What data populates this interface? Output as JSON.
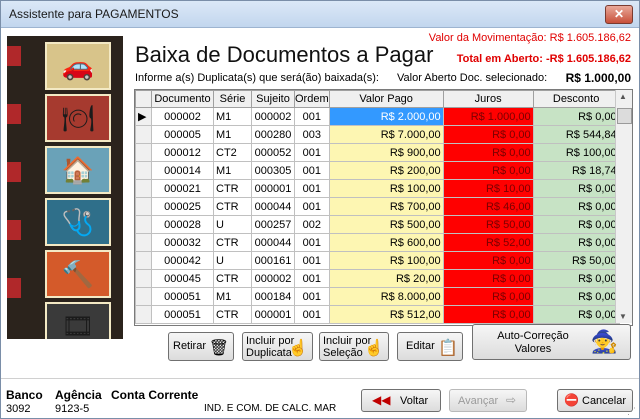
{
  "window": {
    "title": "Assistente para PAGAMENTOS",
    "close_glyph": "✕"
  },
  "header": {
    "heading": "Baixa de Documentos a Pagar",
    "movimentacao": "Valor da Movimentação: R$ 1.605.186,62",
    "aberto": "Total em Aberto: -R$ 1.605.186,62",
    "informe": "Informe a(s) Duplicata(s) que será(ão) baixada(s):",
    "valor_sel_label": "Valor Aberto Doc. selecionado:",
    "valor_sel": "R$ 1.000,00"
  },
  "grid": {
    "columns": [
      "Documento",
      "Série",
      "Sujeito",
      "Ordem",
      "Valor Pago",
      "Juros",
      "Desconto"
    ],
    "current_indicator": "▶",
    "rows": [
      {
        "documento": "000002",
        "serie": "M1",
        "sujeito": "000002",
        "ordem": "001",
        "valor_pago": "R$ 2.000,00",
        "juros": "R$ 1.000,00",
        "desconto": "R$ 0,00"
      },
      {
        "documento": "000005",
        "serie": "M1",
        "sujeito": "000280",
        "ordem": "003",
        "valor_pago": "R$ 7.000,00",
        "juros": "R$ 0,00",
        "desconto": "R$ 544,84"
      },
      {
        "documento": "000012",
        "serie": "CT2",
        "sujeito": "000052",
        "ordem": "001",
        "valor_pago": "R$ 900,00",
        "juros": "R$ 0,00",
        "desconto": "R$ 100,00"
      },
      {
        "documento": "000014",
        "serie": "M1",
        "sujeito": "000305",
        "ordem": "001",
        "valor_pago": "R$ 200,00",
        "juros": "R$ 0,00",
        "desconto": "R$ 18,74"
      },
      {
        "documento": "000021",
        "serie": "CTR",
        "sujeito": "000001",
        "ordem": "001",
        "valor_pago": "R$ 100,00",
        "juros": "R$ 10,00",
        "desconto": "R$ 0,00"
      },
      {
        "documento": "000025",
        "serie": "CTR",
        "sujeito": "000044",
        "ordem": "001",
        "valor_pago": "R$ 700,00",
        "juros": "R$ 46,00",
        "desconto": "R$ 0,00"
      },
      {
        "documento": "000028",
        "serie": "U",
        "sujeito": "000257",
        "ordem": "002",
        "valor_pago": "R$ 500,00",
        "juros": "R$ 50,00",
        "desconto": "R$ 0,00"
      },
      {
        "documento": "000032",
        "serie": "CTR",
        "sujeito": "000044",
        "ordem": "001",
        "valor_pago": "R$ 600,00",
        "juros": "R$ 52,00",
        "desconto": "R$ 0,00"
      },
      {
        "documento": "000042",
        "serie": "U",
        "sujeito": "000161",
        "ordem": "001",
        "valor_pago": "R$ 100,00",
        "juros": "R$ 0,00",
        "desconto": "R$ 50,00"
      },
      {
        "documento": "000045",
        "serie": "CTR",
        "sujeito": "000002",
        "ordem": "001",
        "valor_pago": "R$ 20,00",
        "juros": "R$ 0,00",
        "desconto": "R$ 0,00"
      },
      {
        "documento": "000051",
        "serie": "M1",
        "sujeito": "000184",
        "ordem": "001",
        "valor_pago": "R$ 8.000,00",
        "juros": "R$ 0,00",
        "desconto": "R$ 0,00"
      },
      {
        "documento": "000051",
        "serie": "CTR",
        "sujeito": "000001",
        "ordem": "001",
        "valor_pago": "R$ 512,00",
        "juros": "R$ 0,00",
        "desconto": "R$ 0,00"
      }
    ]
  },
  "buttons": {
    "retirar": "Retirar",
    "incluir_dup": [
      "Incluir por",
      "Duplicata"
    ],
    "incluir_sel": [
      "Incluir por",
      "Seleção"
    ],
    "editar": "Editar",
    "auto": [
      "Auto-Correção",
      "Valores"
    ]
  },
  "footer": {
    "banco_label": "Banco",
    "banco": "3092",
    "agencia_label": "Agência",
    "agencia": "9123-5",
    "conta_label": "Conta Corrente",
    "conta": "IND. E COM. DE CALC. MAR",
    "voltar": "Voltar",
    "avancar": "Avançar",
    "cancelar": "Cancelar"
  },
  "icons": {
    "retirar": "trash-icon",
    "incluir_dup": "hand-pointer-icon",
    "incluir_sel": "hand-pointer-icon",
    "editar": "edit-icon",
    "auto": "wizard-icon",
    "voltar": "double-left-arrow-icon",
    "avancar": "double-right-arrow-icon",
    "cancelar": "cancel-icon"
  },
  "colors": {
    "pago": "#fdf6b2",
    "juros": "#ff0000",
    "desconto": "#c7e3c5",
    "selected": "#3399ff",
    "alert": "#e00000"
  }
}
